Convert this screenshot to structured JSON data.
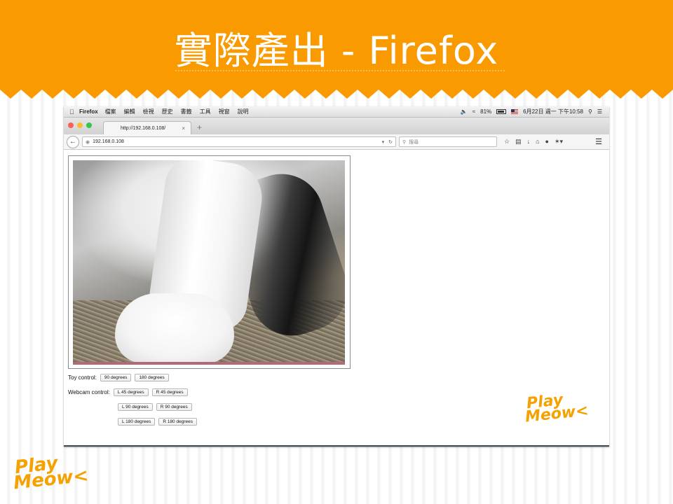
{
  "slide": {
    "title": "實際產出 - Firefox",
    "accent_color": "#f99a00",
    "logo": {
      "line1": "Play",
      "line2": "Meow<"
    }
  },
  "menubar": {
    "apple_icon": "apple-logo-icon",
    "app_name": "Firefox",
    "items": [
      "檔案",
      "編輯",
      "檢視",
      "歷史",
      "書籤",
      "工具",
      "視窗",
      "說明"
    ],
    "battery": "81%",
    "datetime": "6月22日 週一 下午10:58"
  },
  "tab": {
    "title": "http://192.168.0.108/",
    "close": "×",
    "new_tab": "+"
  },
  "navbar": {
    "url": "192.168.0.108",
    "search_placeholder": "搜尋"
  },
  "controls": {
    "toy_label": "Toy control:",
    "toy_buttons": [
      "90 degrees",
      "180 degrees"
    ],
    "webcam_label": "Webcam control:",
    "webcam_rows": [
      [
        "L 45 degrees",
        "R 45 degrees"
      ],
      [
        "L 90 degrees",
        "R 90 degrees"
      ],
      [
        "L 180 degrees",
        "R 180 degrees"
      ]
    ]
  }
}
